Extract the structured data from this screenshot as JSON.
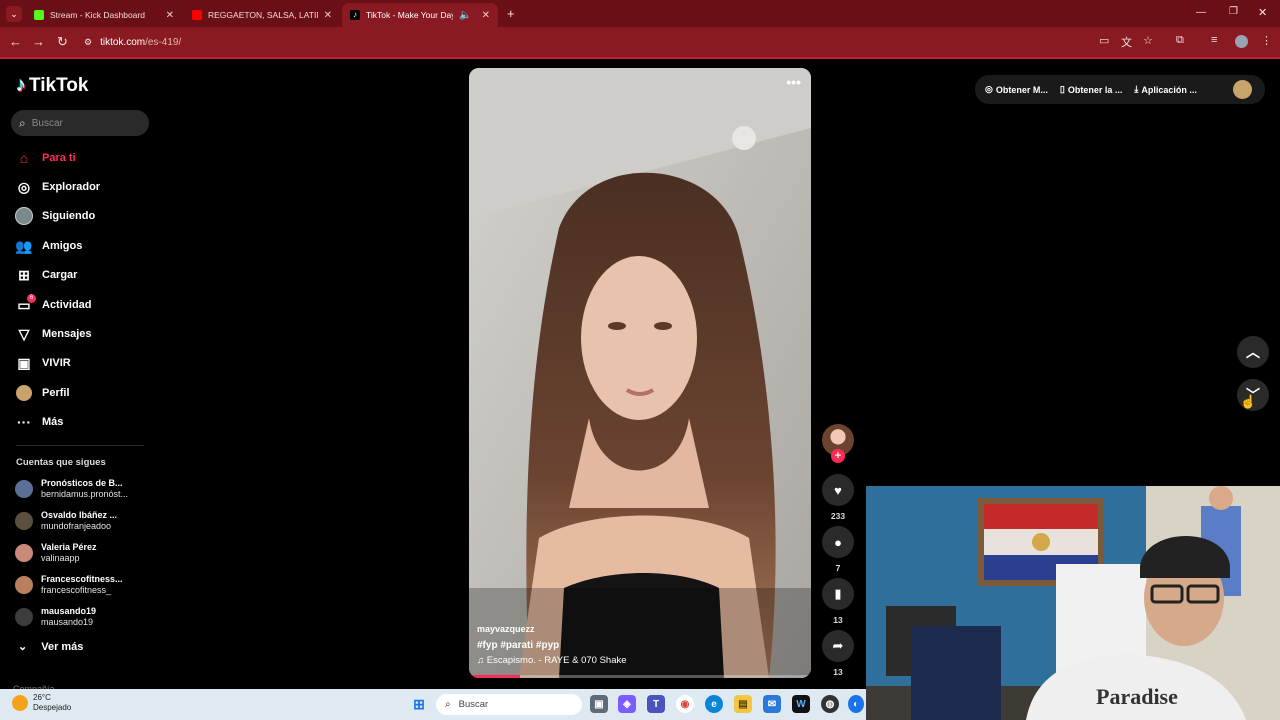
{
  "browser": {
    "tabs": [
      {
        "title": "Stream - Kick Dashboard",
        "icon": "kick-icon",
        "color": "#53fc18"
      },
      {
        "title": "REGGAETON, SALSA, LATIN HIT",
        "icon": "youtube-icon",
        "color": "#ff0000"
      },
      {
        "title": "TikTok - Make Your Day",
        "icon": "tiktok-icon",
        "color": "#000000"
      }
    ],
    "new_tab": "+",
    "url_host": "tiktok.com",
    "url_path": "/es-419/"
  },
  "sidebar": {
    "logo": "TikTok",
    "search_placeholder": "Buscar",
    "nav": [
      {
        "label": "Para ti",
        "icon": "home-icon"
      },
      {
        "label": "Explorador",
        "icon": "compass-icon"
      },
      {
        "label": "Siguiendo",
        "icon": "following-avatar-icon"
      },
      {
        "label": "Amigos",
        "icon": "friends-icon"
      },
      {
        "label": "Cargar",
        "icon": "upload-icon"
      },
      {
        "label": "Actividad",
        "icon": "activity-icon"
      },
      {
        "label": "Mensajes",
        "icon": "messages-icon"
      },
      {
        "label": "VIVIR",
        "icon": "live-icon"
      },
      {
        "label": "Perfil",
        "icon": "profile-icon"
      },
      {
        "label": "Más",
        "icon": "more-icon"
      }
    ],
    "activity_badge": "6",
    "following_title": "Cuentas que sigues",
    "following": [
      {
        "name": "Pronósticos de B...",
        "handle": "bernidamus.pronóst..."
      },
      {
        "name": "Osvaldo Ibáñez ...",
        "handle": "mundofranjeadoo"
      },
      {
        "name": "Valeria Pérez",
        "handle": "valinaapp"
      },
      {
        "name": "Francescofitness...",
        "handle": "francescofitness_"
      },
      {
        "name": "mausando19",
        "handle": "mausando19"
      }
    ],
    "see_more": "Ver más",
    "company": "Compañía"
  },
  "video": {
    "username": "mayvazquezz",
    "tags": "#fyp  #parati  #pyp",
    "song": "Escapismo. - RAYE & 070 Shake",
    "more": "•••",
    "progress": 0.15
  },
  "actions": {
    "likes": "233",
    "comments": "7",
    "saves": "13",
    "shares": "13"
  },
  "topbar": {
    "items": [
      "Obtener M...",
      "Obtener la ...",
      "Aplicación ..."
    ]
  },
  "taskbar": {
    "temp": "26°C",
    "weather": "Despejado",
    "search_placeholder": "Buscar"
  }
}
